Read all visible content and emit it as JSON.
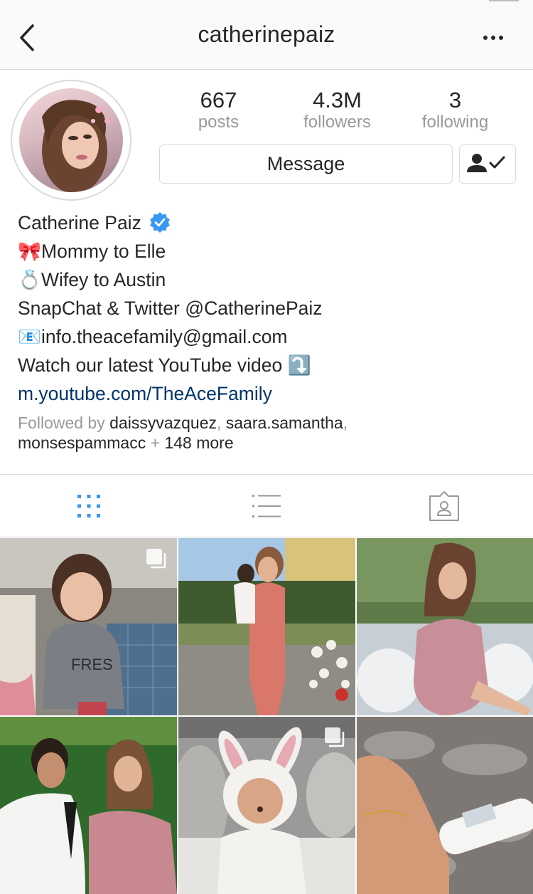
{
  "header": {
    "title": "catherinepaiz",
    "back_icon": "chevron-left-icon",
    "more_icon": "more-horizontal-icon"
  },
  "profile": {
    "stats": [
      {
        "value": "667",
        "label": "posts"
      },
      {
        "value": "4.3M",
        "label": "followers"
      },
      {
        "value": "3",
        "label": "following"
      }
    ],
    "message_label": "Message",
    "following_icon": "user-following-check-icon",
    "verified_color": "#3897f0",
    "name": "Catherine Paiz"
  },
  "bio": {
    "lines": [
      {
        "emoji": "🎀",
        "text": "Mommy to Elle"
      },
      {
        "emoji": "💍",
        "text": "Wifey to Austin"
      },
      {
        "text": "SnapChat & Twitter @CatherinePaiz"
      },
      {
        "emoji": "📧",
        "text": "info.theacefamily@gmail.com"
      },
      {
        "text": "Watch our latest YouTube video",
        "emoji_after": "⤵️"
      }
    ],
    "link": "m.youtube.com/TheAceFamily"
  },
  "followed_by": {
    "prefix": "Followed by",
    "accounts": [
      "daissyvazquez",
      "saara.samantha",
      "monsespammacc"
    ],
    "separator": ",",
    "plus": "+",
    "more": "148 more"
  },
  "tabs": [
    {
      "name": "grid",
      "icon": "grid-icon",
      "active": true
    },
    {
      "name": "list",
      "icon": "list-icon",
      "active": false
    },
    {
      "name": "tagged",
      "icon": "tagged-person-icon",
      "active": false
    }
  ],
  "colors": {
    "active_tab": "#3897f0",
    "inactive_tab": "#999999",
    "link": "#003569",
    "muted": "#999999"
  },
  "posts": [
    {
      "subject": "toddler in grey FRESH sweater",
      "multi": true
    },
    {
      "subject": "mother holding daughter outdoors",
      "multi": false
    },
    {
      "subject": "pregnant woman in pink dress on sofa",
      "multi": false
    },
    {
      "subject": "couple portrait",
      "multi": false
    },
    {
      "subject": "child in bunny hoodie",
      "multi": true
    },
    {
      "subject": "pregnancy test on fur",
      "multi": false
    }
  ]
}
